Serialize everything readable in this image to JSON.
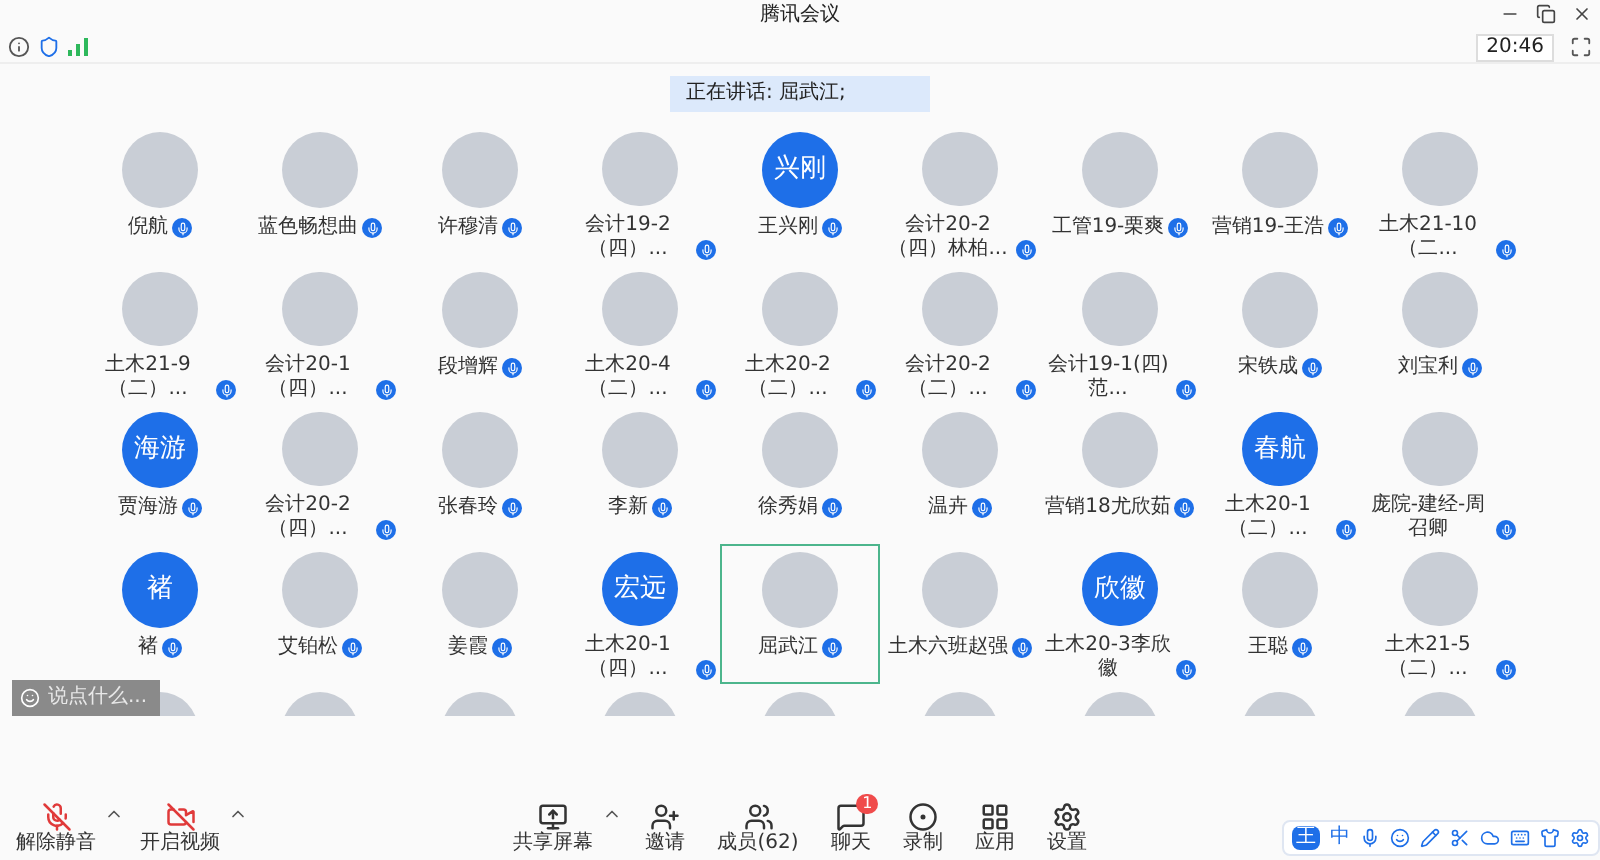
{
  "window": {
    "title": "腾讯会议"
  },
  "info_bar": {
    "time": "20:46"
  },
  "speaking_banner": {
    "text": "正在讲话: 屈武江;"
  },
  "participants": [
    {
      "name": "倪航",
      "kind": "photo",
      "speaking": false
    },
    {
      "name": "蓝色畅想曲",
      "kind": "photo",
      "speaking": false
    },
    {
      "name": "许穆清",
      "kind": "photo",
      "speaking": false
    },
    {
      "name": "会计19-2（四）...",
      "kind": "photo",
      "speaking": false
    },
    {
      "name": "王兴刚",
      "kind": "text",
      "avatar_text": "兴刚",
      "speaking": false
    },
    {
      "name": "会计20-2（四）林柏...",
      "kind": "photo",
      "speaking": false
    },
    {
      "name": "工管19-栗爽",
      "kind": "photo",
      "speaking": false
    },
    {
      "name": "营销19-王浩",
      "kind": "photo",
      "speaking": false
    },
    {
      "name": "土木21-10（二...",
      "kind": "photo",
      "speaking": false
    },
    {
      "name": "土木21-9（二）...",
      "kind": "photo",
      "speaking": false
    },
    {
      "name": "会计20-1（四）...",
      "kind": "photo",
      "speaking": false
    },
    {
      "name": "段增辉",
      "kind": "photo",
      "speaking": false
    },
    {
      "name": "土木20-4（二）...",
      "kind": "photo",
      "speaking": false
    },
    {
      "name": "土木20-2（二）...",
      "kind": "photo",
      "speaking": false
    },
    {
      "name": "会计20-2（二）...",
      "kind": "photo",
      "speaking": false
    },
    {
      "name": "会计19-1(四)范...",
      "kind": "photo",
      "speaking": false
    },
    {
      "name": "宋铁成",
      "kind": "photo",
      "speaking": false
    },
    {
      "name": "刘宝利",
      "kind": "photo",
      "speaking": false
    },
    {
      "name": "贾海游",
      "kind": "text",
      "avatar_text": "海游",
      "speaking": false
    },
    {
      "name": "会计20-2（四）...",
      "kind": "photo",
      "speaking": false
    },
    {
      "name": "张春玲",
      "kind": "photo",
      "speaking": false
    },
    {
      "name": "李新",
      "kind": "photo",
      "speaking": false
    },
    {
      "name": "徐秀娟",
      "kind": "photo",
      "speaking": false
    },
    {
      "name": "温卉",
      "kind": "photo",
      "speaking": false
    },
    {
      "name": "营销18尤欣茹",
      "kind": "photo",
      "speaking": false
    },
    {
      "name": "土木20-1（二）...",
      "kind": "text",
      "avatar_text": "春航",
      "speaking": false
    },
    {
      "name": "庞院-建经-周召卿",
      "kind": "photo",
      "speaking": false
    },
    {
      "name": "褚",
      "kind": "text",
      "avatar_text": "褚",
      "speaking": false
    },
    {
      "name": "艾铂松",
      "kind": "photo",
      "speaking": false
    },
    {
      "name": "姜霞",
      "kind": "photo",
      "speaking": false
    },
    {
      "name": "土木20-1（四）...",
      "kind": "text",
      "avatar_text": "宏远",
      "speaking": false
    },
    {
      "name": "屈武江",
      "kind": "photo",
      "speaking": true
    },
    {
      "name": "土木六班赵强",
      "kind": "photo",
      "speaking": false
    },
    {
      "name": "土木20-3李欣徽",
      "kind": "text",
      "avatar_text": "欣徽",
      "speaking": false
    },
    {
      "name": "王聪",
      "kind": "photo",
      "speaking": false
    },
    {
      "name": "土木21-5（二）...",
      "kind": "photo",
      "speaking": false
    },
    {
      "kind": "photo",
      "speaking": false
    },
    {
      "kind": "photo",
      "speaking": false
    },
    {
      "kind": "photo",
      "speaking": false
    },
    {
      "kind": "photo",
      "speaking": false
    },
    {
      "kind": "photo",
      "speaking": false
    },
    {
      "kind": "photo",
      "speaking": false
    },
    {
      "kind": "photo",
      "speaking": false
    },
    {
      "kind": "photo",
      "speaking": false
    },
    {
      "kind": "photo",
      "speaking": false
    }
  ],
  "chat_input": {
    "placeholder": "说点什么..."
  },
  "toolbar": {
    "left": [
      {
        "kind": "mic",
        "label": "解除静音",
        "has_menu": true
      },
      {
        "kind": "video",
        "label": "开启视频",
        "has_menu": true
      }
    ],
    "center": [
      {
        "kind": "share",
        "label": "共享屏幕",
        "has_menu": true
      },
      {
        "kind": "invite",
        "label": "邀请",
        "has_menu": false
      },
      {
        "kind": "members",
        "label": "成员(62)",
        "has_menu": false
      },
      {
        "kind": "chat",
        "label": "聊天",
        "has_menu": false,
        "badge": "1"
      },
      {
        "kind": "record",
        "label": "录制",
        "has_menu": false
      },
      {
        "kind": "apps",
        "label": "应用",
        "has_menu": false
      },
      {
        "kind": "settings",
        "label": "设置",
        "has_menu": false
      }
    ]
  },
  "ime_bar": {
    "items": [
      "王",
      "中"
    ]
  }
}
